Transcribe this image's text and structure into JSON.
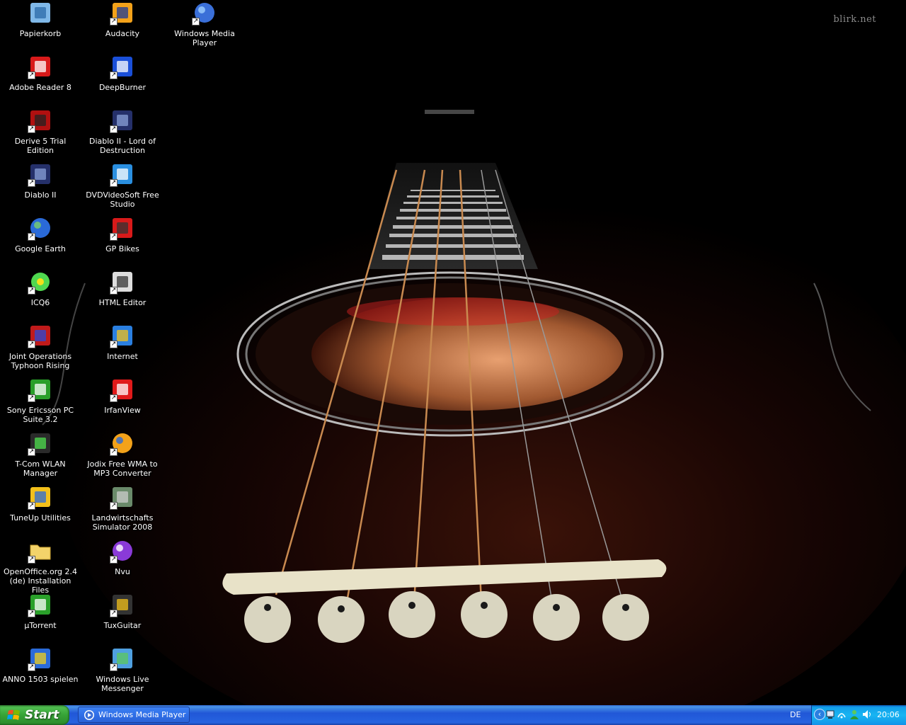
{
  "watermark": "blirk.net",
  "icons": [
    {
      "label": "Papierkorb",
      "icon": "recycle-bin-icon"
    },
    {
      "label": "Audacity",
      "icon": "audacity-icon"
    },
    {
      "label": "Windows Media Player",
      "icon": "windows-media-player-icon"
    },
    {
      "label": "Adobe Reader 8",
      "icon": "adobe-reader-icon"
    },
    {
      "label": "DeepBurner",
      "icon": "deepburner-icon"
    },
    {
      "label": "Derive 5 Trial Edition",
      "icon": "derive-icon"
    },
    {
      "label": "Diablo II - Lord of Destruction",
      "icon": "diablo-lod-icon"
    },
    {
      "label": "Diablo II",
      "icon": "diablo-icon"
    },
    {
      "label": "DVDVideoSoft Free Studio",
      "icon": "dvdvideosoft-icon"
    },
    {
      "label": "Google Earth",
      "icon": "google-earth-icon"
    },
    {
      "label": "GP Bikes",
      "icon": "gp-bikes-icon"
    },
    {
      "label": "ICQ6",
      "icon": "icq-icon"
    },
    {
      "label": "HTML Editor",
      "icon": "html-editor-icon"
    },
    {
      "label": "Joint Operations Typhoon Rising",
      "icon": "joint-operations-icon"
    },
    {
      "label": "Internet",
      "icon": "internet-explorer-icon"
    },
    {
      "label": "Sony Ericsson PC Suite 3.2",
      "icon": "sony-ericsson-icon"
    },
    {
      "label": "IrfanView",
      "icon": "irfanview-icon"
    },
    {
      "label": "T-Com WLAN Manager",
      "icon": "wlan-manager-icon"
    },
    {
      "label": "Jodix Free WMA to MP3 Converter",
      "icon": "jodix-icon"
    },
    {
      "label": "TuneUp Utilities",
      "icon": "tuneup-icon"
    },
    {
      "label": "Landwirtschafts Simulator 2008",
      "icon": "landwirtschafts-icon"
    },
    {
      "label": "OpenOffice.org 2.4 (de) Installation Files",
      "icon": "folder-icon"
    },
    {
      "label": "Nvu",
      "icon": "nvu-icon"
    },
    {
      "label": "µTorrent",
      "icon": "utorrent-icon"
    },
    {
      "label": "TuxGuitar",
      "icon": "tuxguitar-icon"
    },
    {
      "label": "ANNO 1503 spielen",
      "icon": "anno-icon"
    },
    {
      "label": "Windows Live Messenger",
      "icon": "messenger-icon"
    }
  ],
  "taskbar": {
    "start_label": "Start",
    "task_label": "Windows Media Player",
    "language": "DE",
    "clock": "20:06"
  },
  "colors": {
    "taskbar_blue": "#2157d7",
    "start_green": "#36a336",
    "tray_blue": "#18b5f2"
  }
}
